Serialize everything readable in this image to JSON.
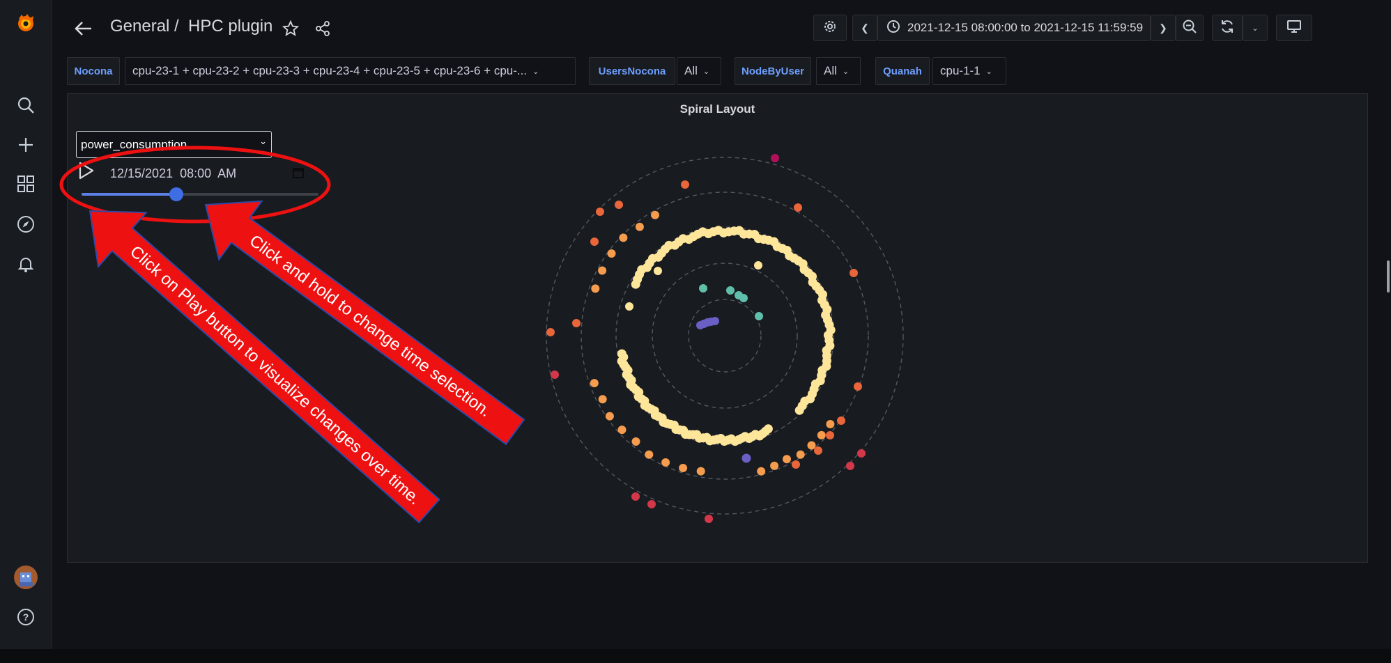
{
  "breadcrumb": {
    "folder": "General",
    "separator": "/",
    "dashboard": "HPC plugin"
  },
  "time_range": {
    "text": "2021-12-15 08:00:00 to 2021-12-15 11:59:59"
  },
  "icons": {
    "logo": "grafana-logo-icon",
    "search": "search-icon",
    "add": "plus-icon",
    "dashboards": "dashboards-grid-icon",
    "explore": "compass-icon",
    "alerting": "bell-icon",
    "profile": "user-avatar",
    "help": "help-icon",
    "back": "arrow-left-icon",
    "star": "star-icon",
    "share": "share-icon",
    "settings": "gear-icon",
    "clock": "clock-icon",
    "zoom_out": "zoom-out-icon",
    "refresh": "refresh-icon",
    "tv": "monitor-icon",
    "play": "play-icon",
    "calendar": "calendar-icon"
  },
  "variables": [
    {
      "label": "Nocona",
      "value": "cpu-23-1 + cpu-23-2 + cpu-23-3 + cpu-23-4 + cpu-23-5 + cpu-23-6 + cpu-..."
    },
    {
      "label": "UsersNocona",
      "value": "All"
    },
    {
      "label": "NodeByUser",
      "value": "All"
    },
    {
      "label": "Quanah",
      "value": "cpu-1-1"
    }
  ],
  "panel": {
    "title": "Spiral Layout",
    "metric_select": "power_consumption",
    "date_value": "12/15/2021  08:00  AM",
    "slider_fraction": 0.4
  },
  "annotations": {
    "arrow_time": "Click and hold to change time selection.",
    "arrow_play": "Click on Play button to visualize changes over time."
  },
  "colors": {
    "background": "#111217",
    "panel": "#181b1f",
    "accent": "#3f6de3",
    "annotation_red": "#ee1111",
    "annotation_border": "#2b4aa8",
    "point_purple": "#6a5fc4",
    "point_teal": "#5fbfab",
    "point_yellow": "#fde59a",
    "point_orange": "#f59c4e",
    "point_red_orange": "#e8663a",
    "point_red": "#d3384a",
    "point_crimson": "#b0125a"
  }
}
